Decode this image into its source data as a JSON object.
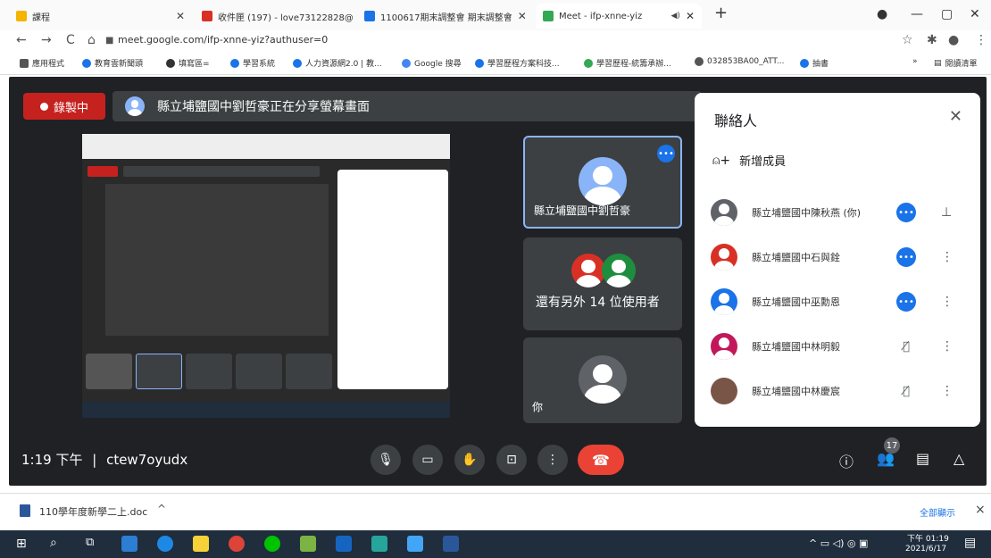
{
  "tabs": [
    {
      "label": "課程",
      "color": "#f4b400"
    },
    {
      "label": "收件匣 (197) - love73122828@...",
      "color": "#d93025"
    },
    {
      "label": "1100617期末調整會 期末調整會",
      "color": "#1a73e8"
    },
    {
      "label": "Meet - ifp-xnne-yiz",
      "color": "#34a853"
    }
  ],
  "new_tab": "+",
  "url": "meet.google.com/ifp-xnne-yiz?authuser=0",
  "bookmarks": [
    {
      "label": "應用程式",
      "color": "#555"
    },
    {
      "label": "教育雲新聞頭",
      "color": "#1a73e8"
    },
    {
      "label": "填寫區=",
      "color": "#333"
    },
    {
      "label": "學習系統",
      "color": "#1a73e8"
    },
    {
      "label": "人力資源網2.0 | 教...",
      "color": "#1a73e8"
    },
    {
      "label": "Google 搜尋",
      "color": "#4285f4"
    },
    {
      "label": "學習歷程方案科技...",
      "color": "#1a73e8"
    },
    {
      "label": "學習歷程-統籌承辦...",
      "color": "#34a853"
    },
    {
      "label": "032853BA00_ATT...",
      "color": "#555"
    },
    {
      "label": "抽書",
      "color": "#1a73e8"
    }
  ],
  "bookmarks_more": "»",
  "reading_list": "閱讀清單",
  "meet": {
    "recording": "錄製中",
    "presenting": "縣立埔鹽國中劉哲豪正在分享螢幕畫面",
    "tile_presenter": "縣立埔鹽國中劉哲豪",
    "tile_others": "還有另外 14 位使用者",
    "tile_you": "你",
    "time": "1:19 下午",
    "separator": "|",
    "code": "ctew7oyudx",
    "participant_count": "17"
  },
  "panel": {
    "title": "聯絡人",
    "add": "新增成員",
    "people": [
      {
        "name": "縣立埔鹽國中陳秋燕 (你)",
        "color": "#5f6368",
        "status": "more",
        "menu": "pin"
      },
      {
        "name": "縣立埔鹽國中石與銓",
        "color": "#d93025",
        "status": "more",
        "menu": "⋮"
      },
      {
        "name": "縣立埔鹽國中巫勳恩",
        "color": "#1a73e8",
        "status": "more",
        "menu": "⋮"
      },
      {
        "name": "縣立埔鹽國中林明毅",
        "color": "#c2185b",
        "status": "muted",
        "menu": "⋮"
      },
      {
        "name": "縣立埔鹽國中林慶宸",
        "color": "#795548",
        "status": "muted",
        "menu": "⋮"
      }
    ]
  },
  "download": {
    "file": "110學年度新學二上.doc",
    "show_all": "全部顯示",
    "close": "×"
  },
  "taskbar": {
    "time": "下午 01:19",
    "date": "2021/6/17"
  }
}
